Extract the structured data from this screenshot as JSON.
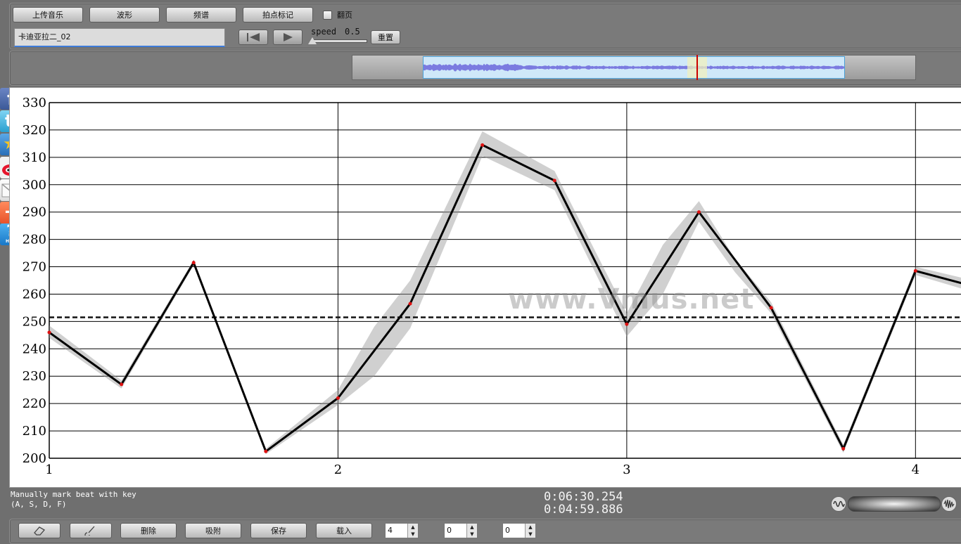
{
  "toolbar": {
    "upload_label": "上传音乐",
    "waveform_label": "波形",
    "spectrum_label": "频谱",
    "beat_mark_label": "拍点标记",
    "page_turn_label": "翻页",
    "song_title": "卡迪亚拉二_02",
    "speed_label": "speed",
    "speed_value": "0.5",
    "reset_label": "重置"
  },
  "sidebar": {
    "icons": [
      "facebook-icon",
      "twitter-icon",
      "favorite-star-icon",
      "weibo-icon",
      "mail-icon",
      "add-plus-icon",
      "help-icon"
    ],
    "help_text": "HELP"
  },
  "watermark": "www.Vmus.net",
  "status": {
    "hint_line1": "Manually mark beat with key",
    "hint_line2": "(A, S, D, F)",
    "time_total": "0:06:30.254",
    "time_current": "0:04:59.886"
  },
  "bottom_toolbar": {
    "delete_label": "删除",
    "snap_label": "吸附",
    "save_label": "保存",
    "load_label": "载入",
    "stepper1_value": "4",
    "stepper2_value": "0",
    "stepper3_value": "0"
  },
  "chart_data": {
    "type": "line",
    "x_ticks": [
      "1",
      "2",
      "3",
      "4"
    ],
    "y_ticks": [
      "200",
      "210",
      "220",
      "230",
      "240",
      "250",
      "260",
      "270",
      "280",
      "290",
      "300",
      "310",
      "320",
      "330"
    ],
    "xlim": [
      1,
      4.16
    ],
    "ylim": [
      200,
      330
    ],
    "average_line": 251.5,
    "series": [
      {
        "points": [
          [
            1,
            246
          ],
          [
            1.25,
            227
          ],
          [
            1.5,
            271.5
          ],
          [
            1.75,
            202.5
          ],
          [
            2,
            222
          ],
          [
            2.25,
            256.5
          ],
          [
            2.5,
            314.5
          ],
          [
            2.75,
            301.5
          ],
          [
            3,
            249
          ],
          [
            3.25,
            290
          ],
          [
            3.5,
            255
          ],
          [
            3.75,
            203.5
          ],
          [
            4,
            268.5
          ],
          [
            4.16,
            264
          ]
        ]
      }
    ],
    "band": {
      "upper": [
        [
          1,
          248.5
        ],
        [
          1.25,
          228.5
        ],
        [
          1.5,
          272.5
        ],
        [
          1.75,
          203.5
        ],
        [
          2,
          225
        ],
        [
          2.125,
          248
        ],
        [
          2.25,
          265
        ],
        [
          2.5,
          319.5
        ],
        [
          2.75,
          305
        ],
        [
          3,
          253
        ],
        [
          3.125,
          278
        ],
        [
          3.25,
          294
        ],
        [
          3.375,
          273
        ],
        [
          3.5,
          257
        ],
        [
          3.75,
          205
        ],
        [
          4,
          270
        ],
        [
          4.16,
          266
        ]
      ],
      "lower": [
        [
          1,
          244
        ],
        [
          1.25,
          225.5
        ],
        [
          1.5,
          270.5
        ],
        [
          1.75,
          201.5
        ],
        [
          2,
          219.5
        ],
        [
          2.125,
          230
        ],
        [
          2.25,
          247.5
        ],
        [
          2.5,
          310.5
        ],
        [
          2.75,
          298
        ],
        [
          3,
          244.5
        ],
        [
          3.125,
          260
        ],
        [
          3.25,
          286.5
        ],
        [
          3.375,
          268
        ],
        [
          3.5,
          253
        ],
        [
          3.75,
          202
        ],
        [
          4,
          267
        ],
        [
          4.16,
          262
        ]
      ]
    },
    "grid": true
  }
}
